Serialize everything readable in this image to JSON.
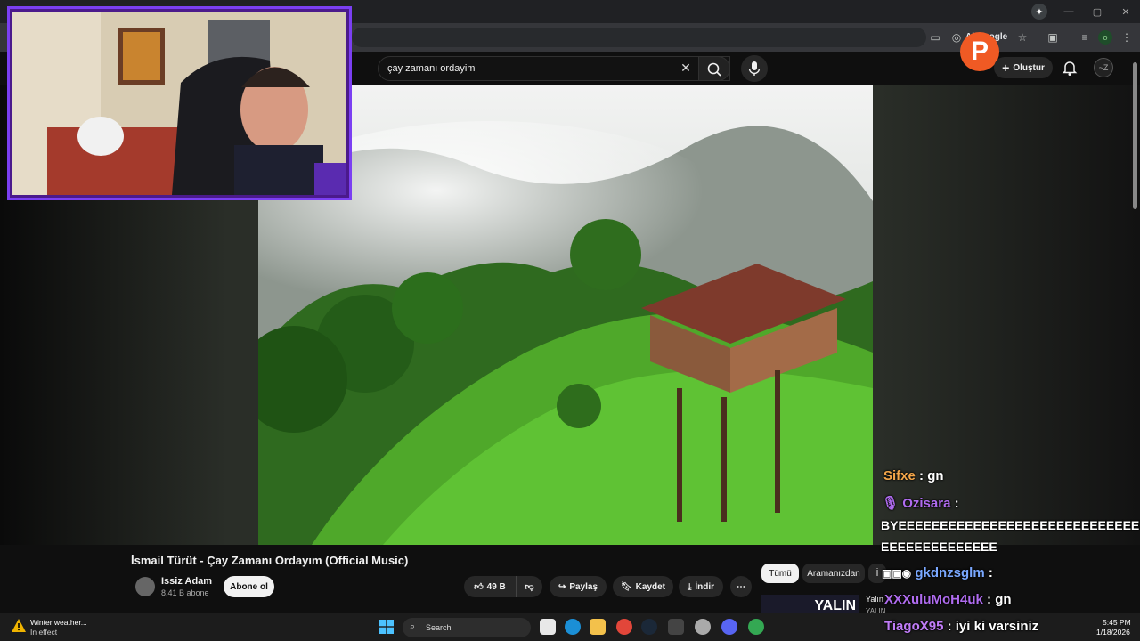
{
  "browser": {
    "omnibox_hint": "Ai Google",
    "gemini_glyph": "✦",
    "win_controls": [
      "—",
      "▢",
      "✕"
    ]
  },
  "youtube": {
    "search_value": "çay zamanı ordayim",
    "create_label": "Oluştur",
    "video_title": "İsmail Türüt - Çay Zamanı Ordayım (Official Music)",
    "channel_name": "Issiz Adam",
    "subscribers": "8,41 B abone",
    "subscribe_label": "Abone ol",
    "like_count": "49 B",
    "share_label": "Paylaş",
    "save_label": "Kaydet",
    "download_label": "İndir",
    "more_glyph": "⋯",
    "chips": [
      "Tümü",
      "Aramanızdan",
      "İ"
    ],
    "rec_title": "Yalın",
    "rec_sub": "YALIN",
    "rec_thumb_text": "YALIN"
  },
  "avatar_text": "~Z",
  "plogo_letter": "P",
  "chat": {
    "messages": [
      {
        "user": "Sifxe",
        "sep": ":",
        "text": "gn",
        "color": "#f3a64a"
      },
      {
        "user": "Ozisara",
        "sep": ":",
        "text": "BYEEEEEEEEEEEEEEEEEEEEEEEEEEEEEEEEEEEEEEEEEEE",
        "color": "#b06cf0"
      },
      {
        "user": "gkdnzsglm",
        "sep": ":",
        "text": "",
        "color": "#7aa8ff"
      },
      {
        "user": "XXXuluMoH4uk",
        "sep": ":",
        "text": "gn",
        "color": "#b06cf0"
      },
      {
        "user": "TiagoX95",
        "sep": ":",
        "text": "iyi ki varsiniz",
        "color": "#c07cf7"
      }
    ],
    "ozisara_line1": "BYEEEEEEEEEEEEEEEEEEEEEEEEEEEEE",
    "ozisara_line2": "EEEEEEEEEEEEEE"
  },
  "taskbar": {
    "weather_title": "Winter weather...",
    "weather_sub": "In effect",
    "search_label": "Search",
    "time": "5:45 PM",
    "date": "1/18/2026"
  },
  "colors": {
    "accent": "#7b3ff2",
    "brand": "#f05a24"
  }
}
